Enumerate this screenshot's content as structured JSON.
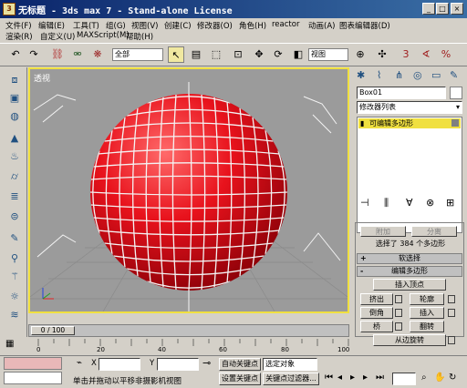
{
  "window": {
    "title": "无标题 - 3ds max 7 - Stand-alone License",
    "min_label": "_",
    "max_label": "□",
    "close_label": "×"
  },
  "menu": {
    "row1": [
      "文件(F)",
      "编辑(E)",
      "工具(T)",
      "组(G)",
      "视图(V)",
      "创建(C)",
      "修改器(O)",
      "角色(H)",
      "reactor",
      "动画(A)",
      "图表编辑器(D)"
    ],
    "row2": [
      "渲染(R)",
      "自定义(U)",
      "MAXScript(M)",
      "帮助(H)"
    ]
  },
  "toolbar": {
    "selection_filter": "全部",
    "ref_coord": "视图"
  },
  "viewport": {
    "label": "透视",
    "active_color": "#f0e040",
    "object_color": "#e8121c",
    "wire_color": "#f4f4f4"
  },
  "command_panel": {
    "object_name": "Box01",
    "modifier_list": "修改器列表",
    "stack_item": "可编辑多边形",
    "selection_info": "选择了 384 个多边形",
    "buttons": {
      "attach": "附加",
      "detach": "分离",
      "insert_vertex": "插入顶点",
      "extrude": "挤出",
      "outline": "轮廓",
      "bevel": "倒角",
      "insert": "插入",
      "bridge": "桥",
      "flip": "翻转",
      "hinge_rotate": "从边旋转"
    },
    "rollouts": {
      "soft_selection": "软选择",
      "edit_polygons": "编辑多边形"
    },
    "plus": "+",
    "minus": "-"
  },
  "timeline": {
    "frame": "0 / 100",
    "ticks": [
      "0",
      "20",
      "40",
      "60",
      "80",
      "100"
    ]
  },
  "status": {
    "prompt": "单击并拖动以平移非摄影机视图",
    "auto_key": "自动关键点",
    "set_key": "设置关键点",
    "selected_object": "选定对象",
    "key_filters": "关键点过滤器...",
    "x_label": "X",
    "y_label": "Y"
  }
}
